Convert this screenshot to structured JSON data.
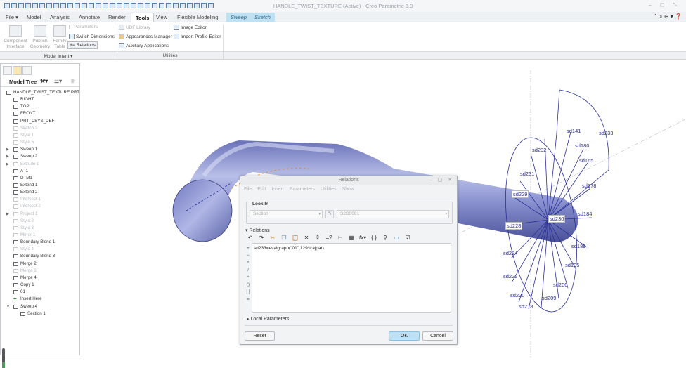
{
  "window": {
    "title": "HANDLE_TWIST_TEXTURE (Active) - Creo Parametric 3.0",
    "controls": "– ▢ ⤡"
  },
  "tabs": [
    "File ▾",
    "Model",
    "Analysis",
    "Annotate",
    "Render",
    "Tools",
    "View",
    "Flexible Modeling",
    "Sweep",
    "Sketch"
  ],
  "active_tab": "Tools",
  "ribbon": {
    "model_intent": {
      "label": "Model Intent ▾",
      "component_interface": "Component\nInterface",
      "publish_geometry": "Publish\nGeometry",
      "family_table": "Family\nTable",
      "parameters": "Parameters",
      "switch_dimensions": "Switch Dimensions",
      "relations": "Relations"
    },
    "utilities": {
      "label": "Utilities",
      "udf_library": "UDF Library",
      "appearances_manager": "Appearances Manager",
      "auxiliary_applications": "Auxiliary Applications",
      "image_editor": "Image Editor",
      "import_profile_editor": "Import Profile Editor"
    }
  },
  "model_tree": {
    "title": "Model Tree",
    "items": [
      {
        "label": "HANDLE_TWIST_TEXTURE.PRT",
        "indent": 0,
        "dim": false,
        "expand": ""
      },
      {
        "label": "RIGHT",
        "indent": 1,
        "dim": false,
        "expand": ""
      },
      {
        "label": "TOP",
        "indent": 1,
        "dim": false,
        "expand": ""
      },
      {
        "label": "FRONT",
        "indent": 1,
        "dim": false,
        "expand": ""
      },
      {
        "label": "PRT_CSYS_DEF",
        "indent": 1,
        "dim": false,
        "expand": ""
      },
      {
        "label": "Sketch 2",
        "indent": 1,
        "dim": true,
        "expand": ""
      },
      {
        "label": "Style 1",
        "indent": 1,
        "dim": true,
        "expand": ""
      },
      {
        "label": "Style 5",
        "indent": 1,
        "dim": true,
        "expand": ""
      },
      {
        "label": "Sweep 1",
        "indent": 1,
        "dim": false,
        "expand": "▶"
      },
      {
        "label": "Sweep 2",
        "indent": 1,
        "dim": false,
        "expand": "▶"
      },
      {
        "label": "Extrude 1",
        "indent": 1,
        "dim": true,
        "expand": "▶"
      },
      {
        "label": "A_1",
        "indent": 1,
        "dim": false,
        "expand": ""
      },
      {
        "label": "DTM1",
        "indent": 1,
        "dim": false,
        "expand": ""
      },
      {
        "label": "Extend 1",
        "indent": 1,
        "dim": false,
        "expand": ""
      },
      {
        "label": "Extend 2",
        "indent": 1,
        "dim": false,
        "expand": ""
      },
      {
        "label": "Intersect 1",
        "indent": 1,
        "dim": true,
        "expand": ""
      },
      {
        "label": "Intersect 2",
        "indent": 1,
        "dim": true,
        "expand": ""
      },
      {
        "label": "Project 1",
        "indent": 1,
        "dim": true,
        "expand": "▶"
      },
      {
        "label": "Style 2",
        "indent": 1,
        "dim": true,
        "expand": ""
      },
      {
        "label": "Style 3",
        "indent": 1,
        "dim": true,
        "expand": ""
      },
      {
        "label": "Mirror 1",
        "indent": 1,
        "dim": true,
        "expand": ""
      },
      {
        "label": "Boundary Blend 1",
        "indent": 1,
        "dim": false,
        "expand": ""
      },
      {
        "label": "Style 4",
        "indent": 1,
        "dim": true,
        "expand": ""
      },
      {
        "label": "Boundary Blend 3",
        "indent": 1,
        "dim": false,
        "expand": ""
      },
      {
        "label": "Merge 2",
        "indent": 1,
        "dim": false,
        "expand": ""
      },
      {
        "label": "Merge 3",
        "indent": 1,
        "dim": true,
        "expand": ""
      },
      {
        "label": "Merge 4",
        "indent": 1,
        "dim": false,
        "expand": ""
      },
      {
        "label": "Copy 1",
        "indent": 1,
        "dim": false,
        "expand": ""
      },
      {
        "label": "01",
        "indent": 1,
        "dim": false,
        "expand": ""
      },
      {
        "label": "Insert Here",
        "indent": 1,
        "dim": false,
        "expand": ""
      },
      {
        "label": "Sweep 4",
        "indent": 1,
        "dim": false,
        "expand": "▼"
      },
      {
        "label": "Section 1",
        "indent": 2,
        "dim": false,
        "expand": ""
      }
    ]
  },
  "dimensions": [
    "sd233",
    "sd141",
    "sd180",
    "sd165",
    "sd232",
    "sd231",
    "sd178",
    "sd229",
    "sd184",
    "sd230",
    "sd228",
    "sd189",
    "sd224",
    "sd195",
    "sd222",
    "sd200",
    "sd220",
    "sd209",
    "sd218"
  ],
  "relations_dialog": {
    "title": "Relations",
    "menu": [
      "File",
      "Edit",
      "Insert",
      "Parameters",
      "Utilities",
      "Show"
    ],
    "look_in_label": "Look In",
    "look_in_type": "Section",
    "look_in_object": "S2D0001",
    "relations_label": "Relations",
    "operators": [
      "+",
      "−",
      "*",
      "/",
      "^",
      "()",
      "[ ]",
      "="
    ],
    "relation_text": "sd233=evalgraph(\"01\",129*trajpar)",
    "local_parameters_label": "Local Parameters",
    "reset": "Reset",
    "ok": "OK",
    "cancel": "Cancel"
  },
  "colors": {
    "accent": "#bfe0f3",
    "model": "#8088c8",
    "sketch": "#2a2f9a"
  }
}
